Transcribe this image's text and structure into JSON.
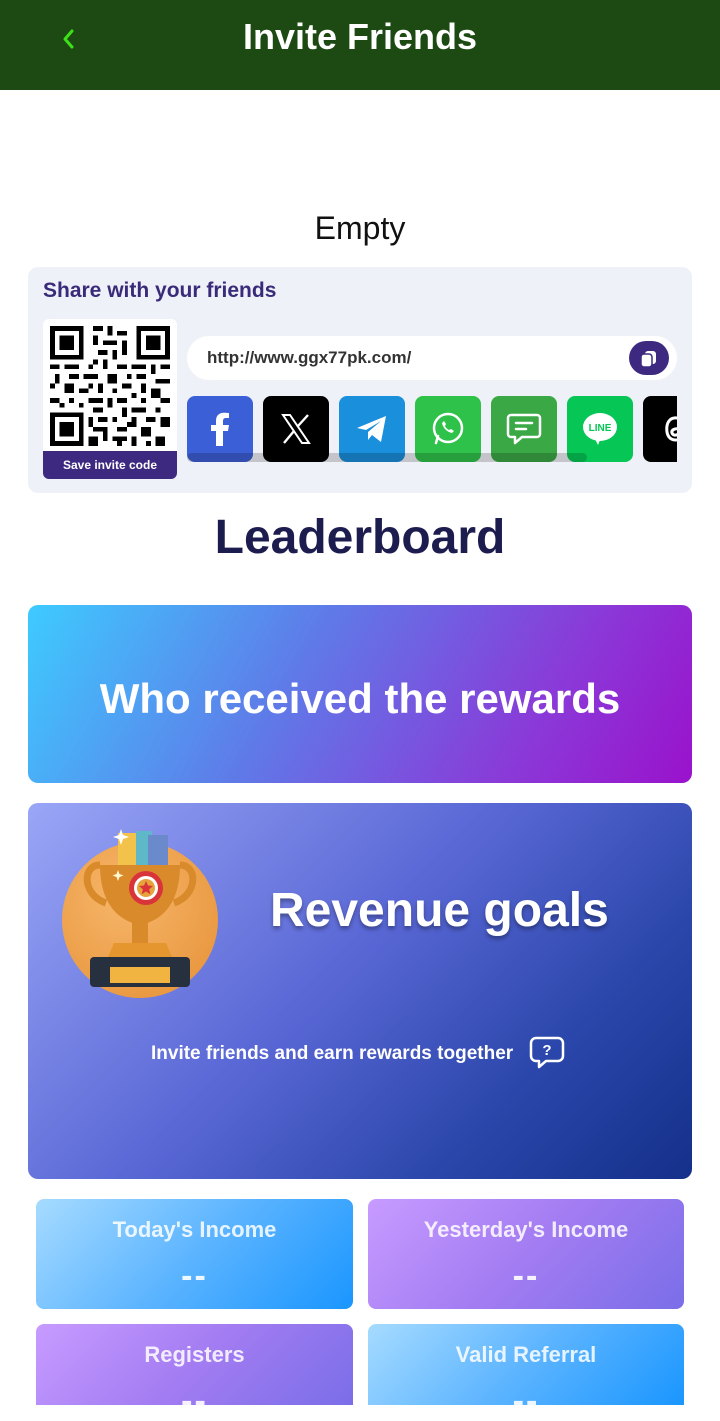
{
  "header": {
    "title": "Invite Friends",
    "back_icon": "chevron-left-icon"
  },
  "colors": {
    "header_bg": "#1d4a12",
    "back_icon": "#3ee01a",
    "accent": "#3d2a80"
  },
  "status": {
    "empty_text": "Empty"
  },
  "share": {
    "title": "Share with your friends",
    "save_label": "Save invite code",
    "link": "http://www.ggx77pk.com/",
    "socials": [
      {
        "name": "facebook",
        "icon": "facebook-icon",
        "color": "#3b5fd6"
      },
      {
        "name": "x",
        "icon": "x-icon",
        "color": "#000000"
      },
      {
        "name": "telegram",
        "icon": "telegram-icon",
        "color": "#1a8fdc"
      },
      {
        "name": "whatsapp",
        "icon": "whatsapp-icon",
        "color": "#2fc24a"
      },
      {
        "name": "sms",
        "icon": "message-icon",
        "color": "#3aa845"
      },
      {
        "name": "line",
        "icon": "line-icon",
        "label": "LINE",
        "color": "#06c755"
      },
      {
        "name": "threads",
        "icon": "threads-icon",
        "color": "#000000"
      }
    ]
  },
  "leaderboard": {
    "title": "Leaderboard",
    "rewards_banner": "Who received the rewards"
  },
  "revenue": {
    "title": "Revenue goals",
    "subtitle": "Invite friends and earn rewards together",
    "help_icon": "question-bubble-icon"
  },
  "stats": [
    {
      "label": "Today's Income",
      "value": "--"
    },
    {
      "label": "Yesterday's Income",
      "value": "--"
    },
    {
      "label": "Registers",
      "value": "--"
    },
    {
      "label": "Valid Referral",
      "value": "--"
    }
  ]
}
